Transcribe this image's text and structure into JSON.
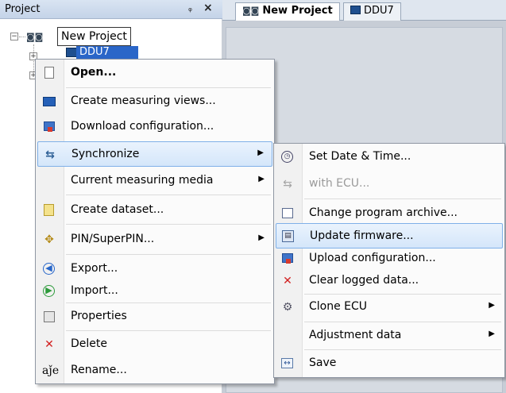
{
  "panel": {
    "title": "Project",
    "pin_glyph": "ᵩ",
    "close_glyph": "×"
  },
  "tree": {
    "project_label": "New Project",
    "device_label": "DDU7",
    "toggle_collapse": "−",
    "toggle_expand": "+"
  },
  "tabs": [
    {
      "label": "New Project",
      "icon": "project-icon",
      "active": true
    },
    {
      "label": "DDU7",
      "icon": "device-icon",
      "active": false
    }
  ],
  "context_menu": {
    "items": [
      {
        "label": "Open...",
        "icon": "document-icon",
        "bold": true
      },
      {
        "label": "Create measuring views...",
        "icon": "measuring-view-icon"
      },
      {
        "label": "Download configuration...",
        "icon": "download-icon"
      },
      {
        "label": "Synchronize",
        "icon": "synchronize-icon",
        "submenu": true,
        "highlighted": true
      },
      {
        "label": "Current measuring media",
        "icon": "",
        "submenu": true
      },
      {
        "label": "Create dataset...",
        "icon": "dataset-icon"
      },
      {
        "label": "PIN/SuperPIN...",
        "icon": "pin-icon",
        "submenu": true
      },
      {
        "label": "Export...",
        "icon": "export-icon"
      },
      {
        "label": "Import...",
        "icon": "import-icon"
      },
      {
        "label": "Properties",
        "icon": "properties-icon"
      },
      {
        "label": "Delete",
        "icon": "delete-icon"
      },
      {
        "label": "Rename...",
        "icon": "rename-icon"
      }
    ]
  },
  "sync_submenu": {
    "items": [
      {
        "label": "Set Date & Time...",
        "icon": "clock-icon"
      },
      {
        "label": "with ECU...",
        "icon": "ecu-sync-icon",
        "disabled": true
      },
      {
        "label": "Change program archive...",
        "icon": "archive-icon"
      },
      {
        "label": "Update firmware...",
        "icon": "firmware-icon",
        "highlighted": true
      },
      {
        "label": "Upload configuration...",
        "icon": "upload-icon"
      },
      {
        "label": "Clear logged data...",
        "icon": "clear-icon"
      },
      {
        "label": "Clone ECU",
        "icon": "clone-icon",
        "submenu": true
      },
      {
        "label": "Adjustment data",
        "icon": "",
        "submenu": true
      },
      {
        "label": "Save",
        "icon": "save-icon"
      }
    ]
  },
  "colors": {
    "header_bg": "#c4d3e8",
    "selection": "#2a66c8",
    "menu_highlight": "#d4e6fa",
    "delete_red": "#d21f1f"
  }
}
